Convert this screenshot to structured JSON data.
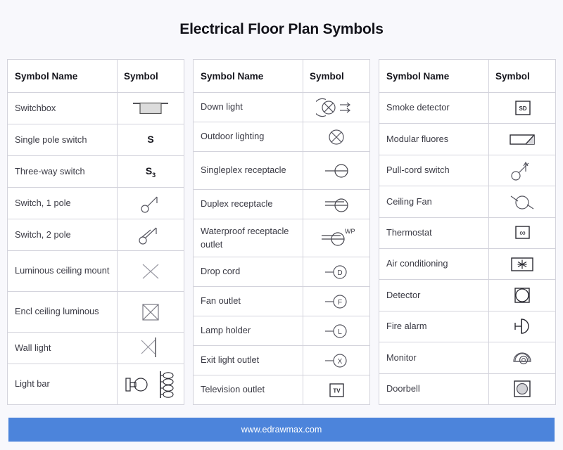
{
  "page": {
    "title": "Electrical Floor Plan Symbols",
    "background_color": "#f8f8fc",
    "accent_color": "#4c84db"
  },
  "footer": {
    "text": "www.edrawmax.com"
  },
  "tables": [
    {
      "id": "table-1",
      "headers": {
        "name": "Symbol Name",
        "symbol": "Symbol"
      },
      "rows": [
        {
          "name": "Switchbox",
          "symbol_name": "switchbox-symbol",
          "lines": 1
        },
        {
          "name": "Single pole switch",
          "symbol_name": "single-pole-switch-symbol",
          "lines": 1
        },
        {
          "name": "Three-way switch",
          "symbol_name": "three-way-switch-symbol",
          "lines": 1
        },
        {
          "name": "Switch, 1 pole",
          "symbol_name": "switch-1-pole-symbol",
          "lines": 1
        },
        {
          "name": "Switch, 2 pole",
          "symbol_name": "switch-2-pole-symbol",
          "lines": 1
        },
        {
          "name": "Luminous ceiling mount",
          "symbol_name": "luminous-ceiling-mount-symbol",
          "lines": 2
        },
        {
          "name": "Encl ceiling luminous",
          "symbol_name": "encl-ceiling-luminous-symbol",
          "lines": 2
        },
        {
          "name": "Wall light",
          "symbol_name": "wall-light-symbol",
          "lines": 1
        },
        {
          "name": "Light bar",
          "symbol_name": "light-bar-symbol",
          "lines": 2
        }
      ]
    },
    {
      "id": "table-2",
      "headers": {
        "name": "Symbol Name",
        "symbol": "Symbol"
      },
      "rows": [
        {
          "name": "Down light",
          "symbol_name": "down-light-symbol",
          "lines": 1
        },
        {
          "name": "Outdoor lighting",
          "symbol_name": "outdoor-lighting-symbol",
          "lines": 1
        },
        {
          "name": "Singleplex receptacle",
          "symbol_name": "singleplex-receptacle-symbol",
          "lines": 2
        },
        {
          "name": "Duplex receptacle",
          "symbol_name": "duplex-receptacle-symbol",
          "lines": 1
        },
        {
          "name": "Waterproof receptacle outlet",
          "symbol_name": "waterproof-receptacle-outlet-symbol",
          "lines": 2
        },
        {
          "name": "Drop cord",
          "symbol_name": "drop-cord-symbol",
          "lines": 1
        },
        {
          "name": "Fan outlet",
          "symbol_name": "fan-outlet-symbol",
          "lines": 1
        },
        {
          "name": "Lamp holder",
          "symbol_name": "lamp-holder-symbol",
          "lines": 1
        },
        {
          "name": "Exit light outlet",
          "symbol_name": "exit-light-outlet-symbol",
          "lines": 1
        },
        {
          "name": "Television outlet",
          "symbol_name": "television-outlet-symbol",
          "lines": 1
        }
      ]
    },
    {
      "id": "table-3",
      "headers": {
        "name": "Symbol Name",
        "symbol": "Symbol"
      },
      "rows": [
        {
          "name": "Smoke detector",
          "symbol_name": "smoke-detector-symbol",
          "lines": 1
        },
        {
          "name": "Modular fluores",
          "symbol_name": "modular-fluores-symbol",
          "lines": 1
        },
        {
          "name": "Pull-cord switch",
          "symbol_name": "pull-cord-switch-symbol",
          "lines": 1
        },
        {
          "name": "Ceiling Fan",
          "symbol_name": "ceiling-fan-symbol",
          "lines": 1
        },
        {
          "name": "Thermostat",
          "symbol_name": "thermostat-symbol",
          "lines": 1
        },
        {
          "name": "Air conditioning",
          "symbol_name": "air-conditioning-symbol",
          "lines": 1
        },
        {
          "name": "Detector",
          "symbol_name": "detector-symbol",
          "lines": 1
        },
        {
          "name": "Fire alarm",
          "symbol_name": "fire-alarm-symbol",
          "lines": 1
        },
        {
          "name": "Monitor",
          "symbol_name": "monitor-symbol",
          "lines": 1
        },
        {
          "name": "Doorbell",
          "symbol_name": "doorbell-symbol",
          "lines": 1
        }
      ]
    }
  ],
  "symbol_text_labels": {
    "single_pole": "S",
    "three_way": "S",
    "three_way_sub": "3",
    "waterproof": "WP",
    "drop_cord": "D",
    "fan_outlet": "F",
    "lamp_holder": "L",
    "exit_light": "X",
    "television": "TV",
    "smoke_detector": "SD"
  }
}
